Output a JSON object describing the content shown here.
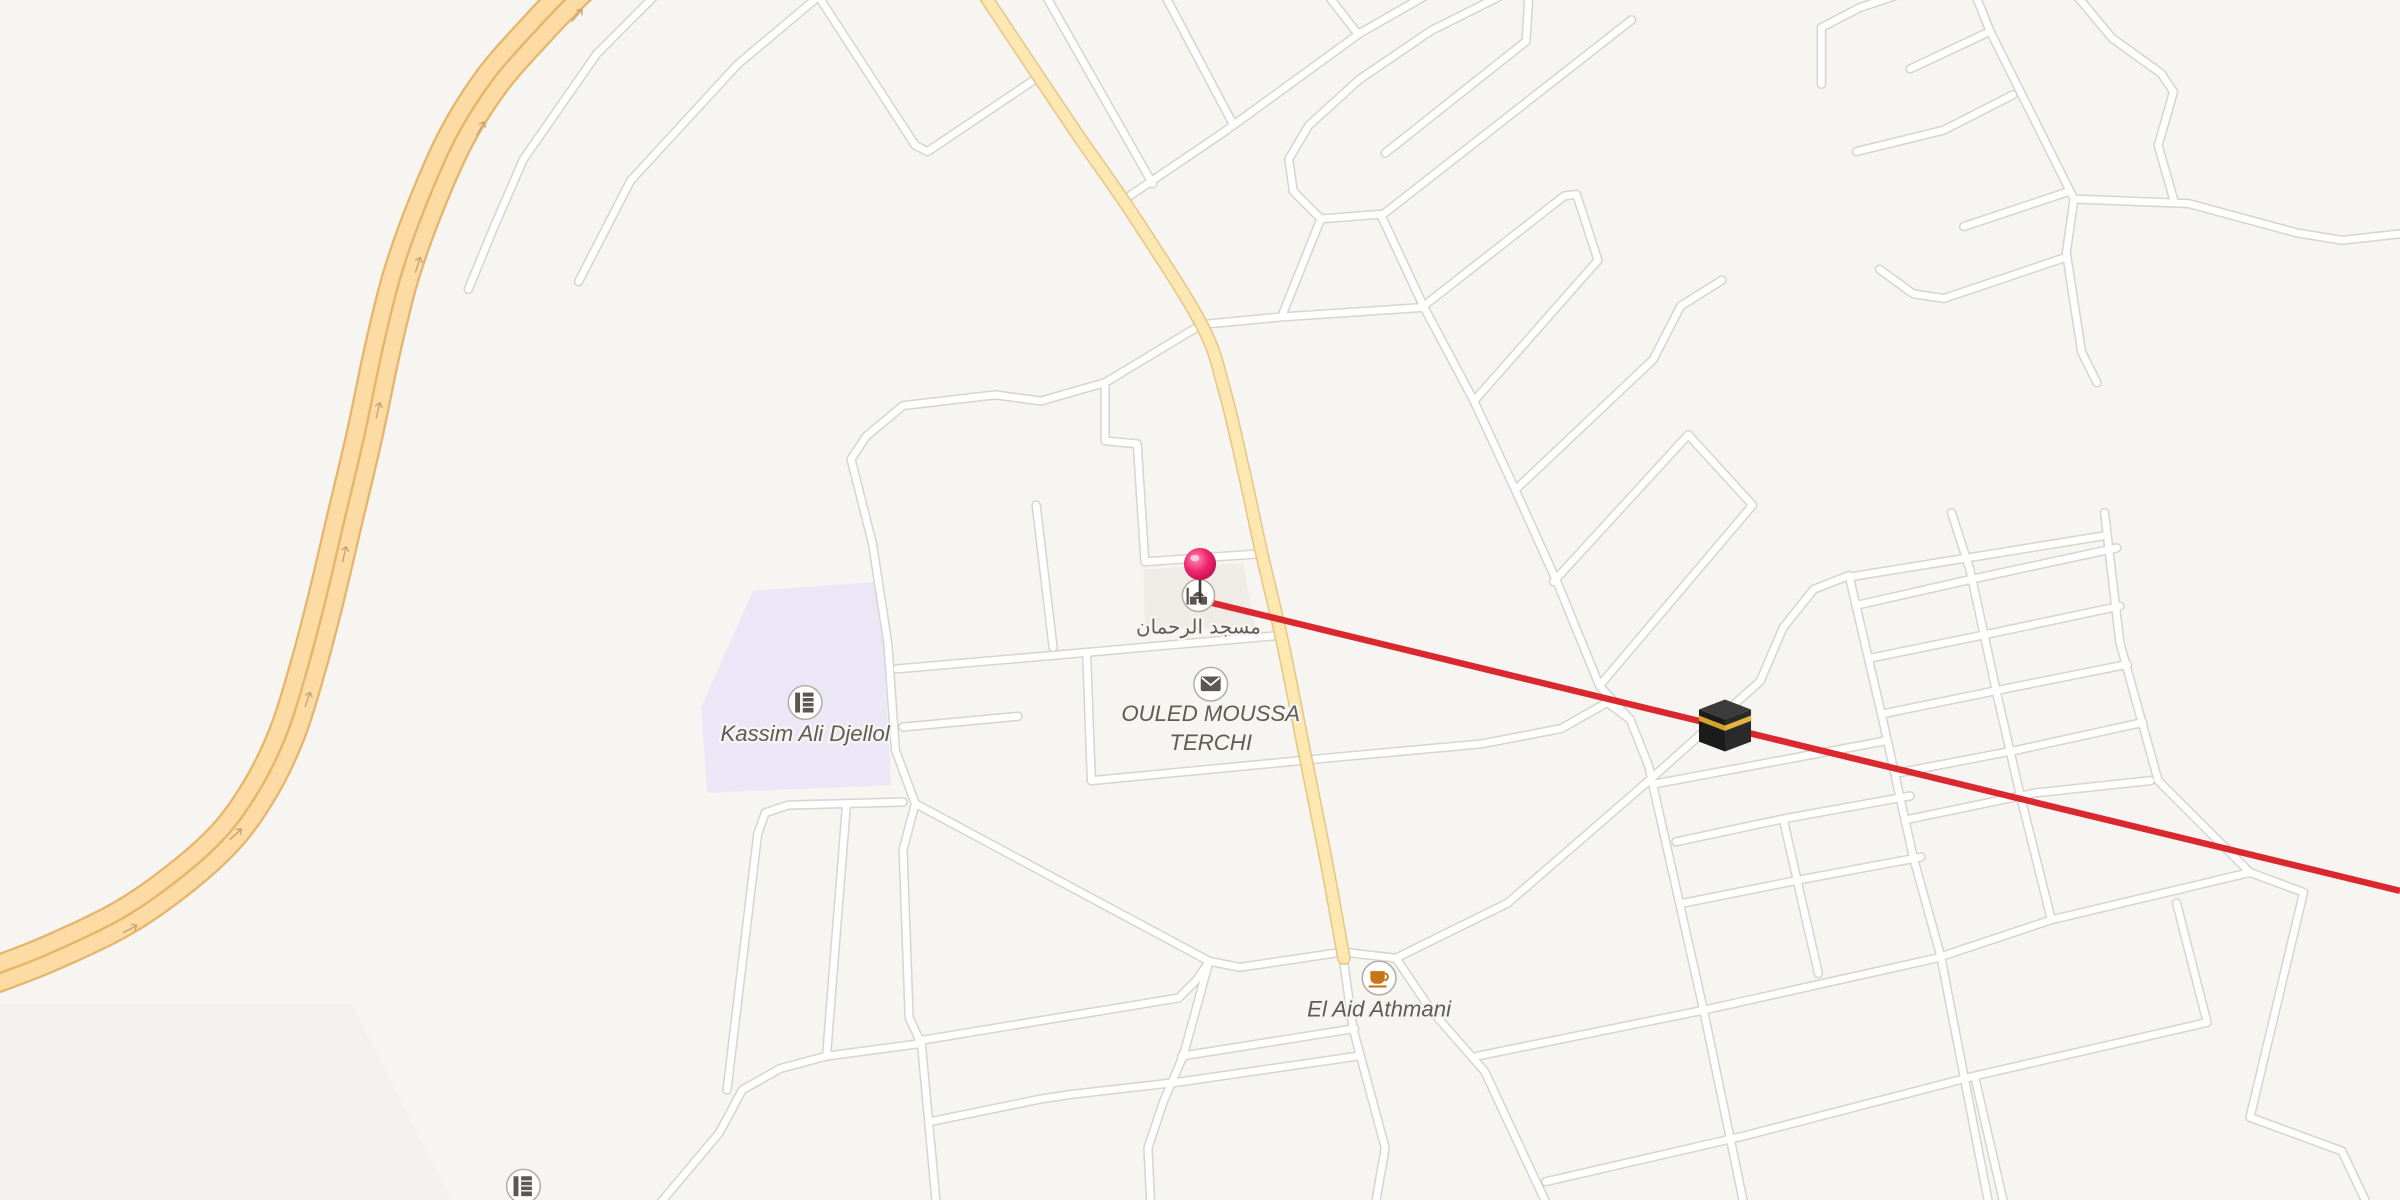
{
  "pois": {
    "mosque": {
      "label": "مسجد الرحمان",
      "icon": "mosque-icon"
    },
    "school": {
      "label": "Kassim Ali Djellol",
      "icon": "library-icon"
    },
    "post_office": {
      "label_line1": "OULED MOUSSA",
      "label_line2": "TERCHI",
      "icon": "post-office-icon"
    },
    "cafe": {
      "label": "El Aid Athmani",
      "icon": "cafe-icon"
    },
    "school_2": {
      "icon": "library-icon"
    }
  },
  "markers": {
    "location_pin": {
      "icon": "location-pin-icon"
    },
    "qibla_target": {
      "icon": "kaaba-icon"
    }
  },
  "colors": {
    "land": "#f7f5f2",
    "street": "#ffffff",
    "street_casing": "#d8d4ce",
    "trunk_road": "#fcdca4",
    "trunk_road_edge": "#e6b56c",
    "secondary_road": "#fde8b2",
    "secondary_road_edge": "#e9c585",
    "school_grounds": "#ece7f7",
    "qibla_line": "#d9282e",
    "location_pin": "#f0266f"
  }
}
